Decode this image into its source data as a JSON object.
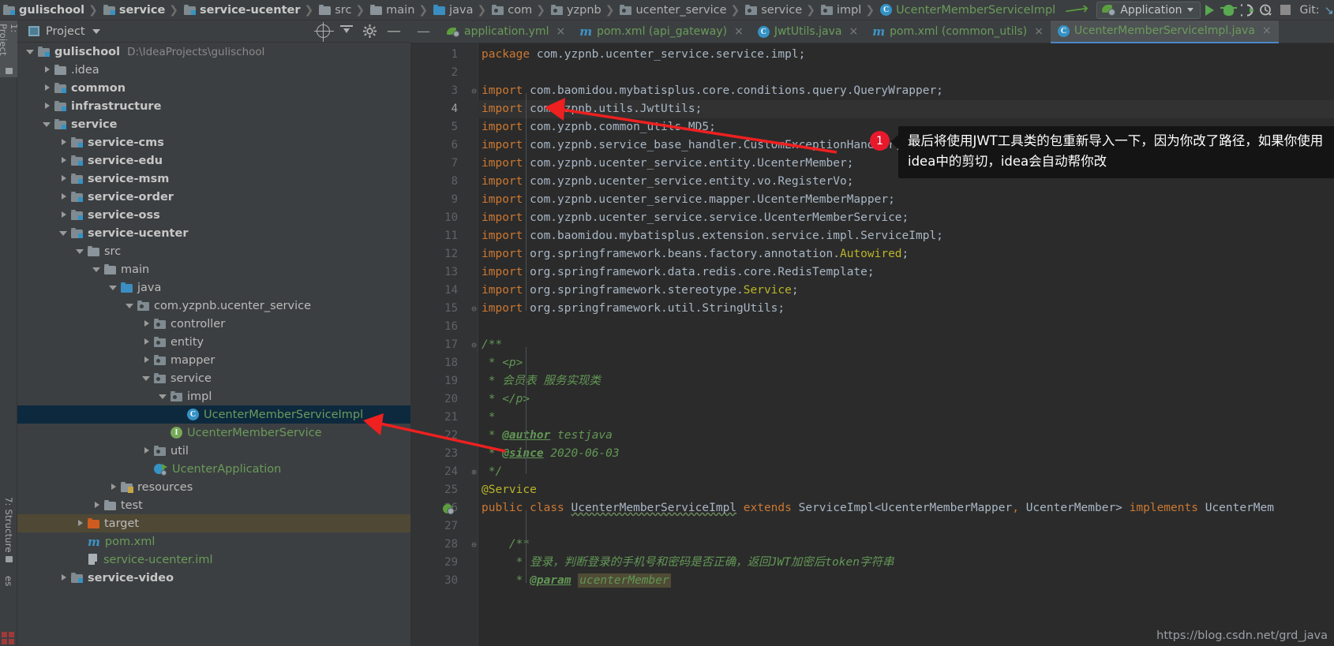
{
  "navbar": {
    "breadcrumbs": [
      {
        "label": "gulischool",
        "icon": "module-folder-icon",
        "bold": true
      },
      {
        "label": "service",
        "icon": "module-folder-icon",
        "bold": true
      },
      {
        "label": "service-ucenter",
        "icon": "module-folder-icon",
        "bold": true
      },
      {
        "label": "src",
        "icon": "folder-icon",
        "bold": false
      },
      {
        "label": "main",
        "icon": "folder-icon",
        "bold": false
      },
      {
        "label": "java",
        "icon": "source-folder-icon",
        "bold": false
      },
      {
        "label": "com",
        "icon": "package-icon",
        "bold": false
      },
      {
        "label": "yzpnb",
        "icon": "package-icon",
        "bold": false
      },
      {
        "label": "ucenter_service",
        "icon": "package-icon",
        "bold": false
      },
      {
        "label": "service",
        "icon": "package-icon",
        "bold": false
      },
      {
        "label": "impl",
        "icon": "package-icon",
        "bold": false
      },
      {
        "label": "UcenterMemberServiceImpl",
        "icon": "java-class-icon",
        "bold": false,
        "green": true
      }
    ],
    "run_config": "Application",
    "git_label": "Git:",
    "buttons": [
      "run-button",
      "debug-button",
      "run-coverage-button",
      "profile-button",
      "stop-button"
    ]
  },
  "toolstrip": {
    "tabs": [
      {
        "label": "1: Project",
        "selected": true
      },
      {
        "label": "7: Structure",
        "selected": false
      },
      {
        "label": "es",
        "selected": false
      }
    ]
  },
  "project_panel": {
    "title": "Project",
    "actions": [
      "locate-icon",
      "collapse-all-icon",
      "settings-gear-icon",
      "hide-icon"
    ],
    "tree": [
      {
        "depth": 0,
        "twisty": "down",
        "icon": "module-folder-icon",
        "label": "gulischool",
        "bold": true,
        "path": "D:\\IdeaProjects\\gulischool"
      },
      {
        "depth": 1,
        "twisty": "right",
        "icon": "folder-icon",
        "label": ".idea"
      },
      {
        "depth": 1,
        "twisty": "right",
        "icon": "module-folder-icon",
        "label": "common",
        "bold": true
      },
      {
        "depth": 1,
        "twisty": "right",
        "icon": "module-folder-icon",
        "label": "infrastructure",
        "bold": true
      },
      {
        "depth": 1,
        "twisty": "down",
        "icon": "module-folder-icon",
        "label": "service",
        "bold": true
      },
      {
        "depth": 2,
        "twisty": "right",
        "icon": "module-folder-icon",
        "label": "service-cms",
        "bold": true
      },
      {
        "depth": 2,
        "twisty": "right",
        "icon": "module-folder-icon",
        "label": "service-edu",
        "bold": true
      },
      {
        "depth": 2,
        "twisty": "right",
        "icon": "module-folder-icon",
        "label": "service-msm",
        "bold": true
      },
      {
        "depth": 2,
        "twisty": "right",
        "icon": "module-folder-icon",
        "label": "service-order",
        "bold": true
      },
      {
        "depth": 2,
        "twisty": "right",
        "icon": "module-folder-icon",
        "label": "service-oss",
        "bold": true
      },
      {
        "depth": 2,
        "twisty": "down",
        "icon": "module-folder-icon",
        "label": "service-ucenter",
        "bold": true
      },
      {
        "depth": 3,
        "twisty": "down",
        "icon": "folder-icon",
        "label": "src"
      },
      {
        "depth": 4,
        "twisty": "down",
        "icon": "folder-icon",
        "label": "main"
      },
      {
        "depth": 5,
        "twisty": "down",
        "icon": "source-folder-icon",
        "label": "java"
      },
      {
        "depth": 6,
        "twisty": "down",
        "icon": "package-icon",
        "label": "com.yzpnb.ucenter_service"
      },
      {
        "depth": 7,
        "twisty": "right",
        "icon": "package-icon",
        "label": "controller"
      },
      {
        "depth": 7,
        "twisty": "right",
        "icon": "package-icon",
        "label": "entity"
      },
      {
        "depth": 7,
        "twisty": "right",
        "icon": "package-icon",
        "label": "mapper"
      },
      {
        "depth": 7,
        "twisty": "down",
        "icon": "package-icon",
        "label": "service"
      },
      {
        "depth": 8,
        "twisty": "down",
        "icon": "package-icon",
        "label": "impl"
      },
      {
        "depth": 9,
        "twisty": "none",
        "icon": "java-class-icon",
        "label": "UcenterMemberServiceImpl",
        "green": true,
        "selected": true
      },
      {
        "depth": 8,
        "twisty": "none",
        "icon": "java-interface-icon",
        "label": "UcenterMemberService",
        "green": true
      },
      {
        "depth": 7,
        "twisty": "right",
        "icon": "package-icon",
        "label": "util"
      },
      {
        "depth": 7,
        "twisty": "none",
        "icon": "spring-boot-app-icon",
        "label": "UcenterApplication",
        "green": true
      },
      {
        "depth": 5,
        "twisty": "right",
        "icon": "resources-folder-icon",
        "label": "resources"
      },
      {
        "depth": 4,
        "twisty": "right",
        "icon": "folder-icon",
        "label": "test"
      },
      {
        "depth": 3,
        "twisty": "right",
        "icon": "target-folder-icon",
        "label": "target",
        "highlight": true
      },
      {
        "depth": 3,
        "twisty": "none",
        "icon": "maven-icon",
        "label": "pom.xml",
        "green": true
      },
      {
        "depth": 3,
        "twisty": "none",
        "icon": "iml-file-icon",
        "label": "service-ucenter.iml",
        "green": true
      },
      {
        "depth": 2,
        "twisty": "right",
        "icon": "module-folder-icon",
        "label": "service-video",
        "bold": true
      }
    ]
  },
  "editor_tabs": [
    {
      "label": "application.yml",
      "icon": "spring-yaml-icon",
      "active": false,
      "close": "×"
    },
    {
      "label": "pom.xml (api_gateway)",
      "icon": "maven-icon",
      "active": false,
      "close": "×"
    },
    {
      "label": "JwtUtils.java",
      "icon": "java-class-icon",
      "active": false,
      "close": "×"
    },
    {
      "label": "pom.xml (common_utils)",
      "icon": "maven-icon",
      "active": false,
      "close": "×"
    },
    {
      "label": "UcenterMemberServiceImpl.java",
      "icon": "java-class-icon",
      "active": true,
      "close": "×"
    }
  ],
  "code_lines": [
    {
      "n": 1,
      "text": "package com.yzpnb.ucenter_service.service.impl;"
    },
    {
      "n": 2,
      "text": ""
    },
    {
      "n": 3,
      "text": "import com.baomidou.mybatisplus.core.conditions.query.QueryWrapper;"
    },
    {
      "n": 4,
      "text": "import com.yzpnb.utils.JwtUtils;",
      "current": true
    },
    {
      "n": 5,
      "text": "import com.yzpnb.common_utils.MD5;"
    },
    {
      "n": 6,
      "text": "import com.yzpnb.service_base_handler.CustomExceptionHandler;"
    },
    {
      "n": 7,
      "text": "import com.yzpnb.ucenter_service.entity.UcenterMember;"
    },
    {
      "n": 8,
      "text": "import com.yzpnb.ucenter_service.entity.vo.RegisterVo;"
    },
    {
      "n": 9,
      "text": "import com.yzpnb.ucenter_service.mapper.UcenterMemberMapper;"
    },
    {
      "n": 10,
      "text": "import com.yzpnb.ucenter_service.service.UcenterMemberService;"
    },
    {
      "n": 11,
      "text": "import com.baomidou.mybatisplus.extension.service.impl.ServiceImpl;"
    },
    {
      "n": 12,
      "text": "import org.springframework.beans.factory.annotation.Autowired;"
    },
    {
      "n": 13,
      "text": "import org.springframework.data.redis.core.RedisTemplate;"
    },
    {
      "n": 14,
      "text": "import org.springframework.stereotype.Service;"
    },
    {
      "n": 15,
      "text": "import org.springframework.util.StringUtils;"
    },
    {
      "n": 16,
      "text": ""
    },
    {
      "n": 17,
      "text": "/**"
    },
    {
      "n": 18,
      "text": " * <p>"
    },
    {
      "n": 19,
      "text": " * 会员表 服务实现类"
    },
    {
      "n": 20,
      "text": " * </p>"
    },
    {
      "n": 21,
      "text": " *"
    },
    {
      "n": 22,
      "text": " * @author testjava"
    },
    {
      "n": 23,
      "text": " * @since 2020-06-03"
    },
    {
      "n": 24,
      "text": " */"
    },
    {
      "n": 25,
      "text": "@Service"
    },
    {
      "n": 26,
      "text": "public class UcenterMemberServiceImpl extends ServiceImpl<UcenterMemberMapper, UcenterMember> implements UcenterMem"
    },
    {
      "n": 27,
      "text": ""
    },
    {
      "n": 28,
      "text": "    /**"
    },
    {
      "n": 29,
      "text": "     * 登录，判断登录的手机号和密码是否正确，返回JWT加密后token字符串"
    },
    {
      "n": 30,
      "text": "     * @param ucenterMember"
    }
  ],
  "annotation": {
    "badge": "1",
    "tooltip_text": "最后将使用JWT工具类的包重新导入一下，因为你改了路径，如果你使用idea中的剪切，idea会自动帮你改",
    "arrow_color": "#ee2020",
    "badge_color": "#e8192c"
  },
  "watermark": "https://blog.csdn.net/grd_java"
}
